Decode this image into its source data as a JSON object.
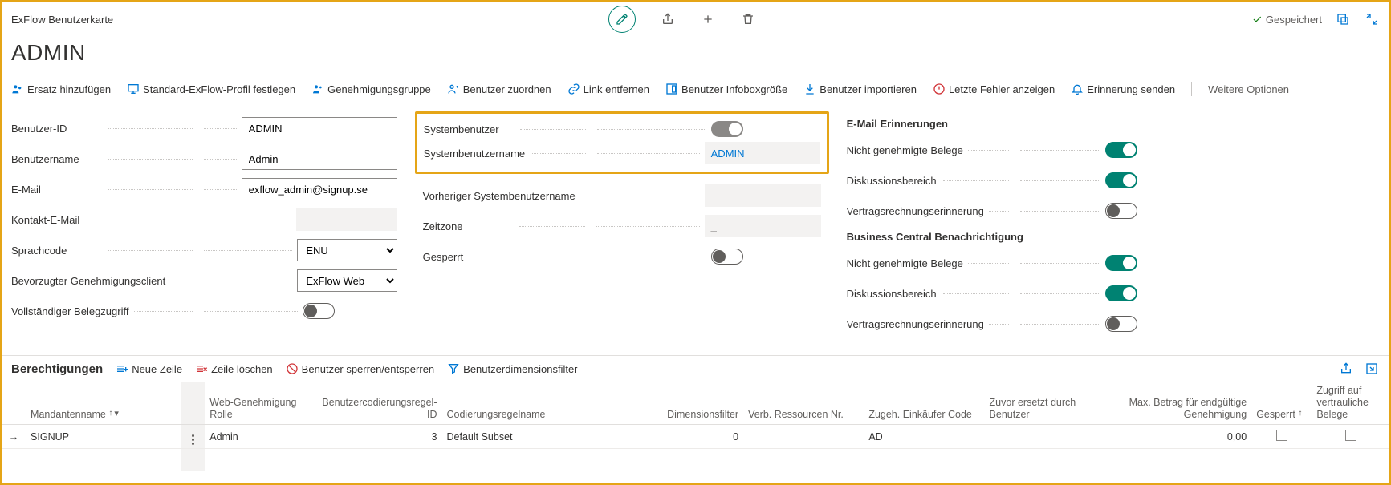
{
  "header": {
    "breadcrumb": "ExFlow Benutzerkarte",
    "title": "ADMIN",
    "saved_label": "Gespeichert"
  },
  "actions": {
    "ersatz": "Ersatz hinzufügen",
    "profil": "Standard-ExFlow-Profil festlegen",
    "gruppe": "Genehmigungsgruppe",
    "zuordnen": "Benutzer zuordnen",
    "link": "Link entfernen",
    "infobox": "Benutzer Infoboxgröße",
    "import": "Benutzer importieren",
    "fehler": "Letzte Fehler anzeigen",
    "erinnerung": "Erinnerung senden",
    "more": "Weitere Optionen"
  },
  "fields": {
    "user_id_label": "Benutzer-ID",
    "user_id": "ADMIN",
    "user_name_label": "Benutzername",
    "user_name": "Admin",
    "email_label": "E-Mail",
    "email": "exflow_admin@signup.se",
    "contact_email_label": "Kontakt-E-Mail",
    "contact_email": "",
    "lang_label": "Sprachcode",
    "lang": "ENU",
    "client_label": "Bevorzugter Genehmigungsclient",
    "client": "ExFlow Web",
    "full_access_label": "Vollständiger Belegzugriff"
  },
  "col2": {
    "sysuser_label": "Systembenutzer",
    "sysuser_name_label": "Systembenutzername",
    "sysuser_name": "ADMIN",
    "prev_sysuser_label": "Vorheriger Systembenutzername",
    "prev_sysuser": "",
    "timezone_label": "Zeitzone",
    "timezone": "_",
    "blocked_label": "Gesperrt"
  },
  "reminders": {
    "email_title": "E-Mail Erinnerungen",
    "not_approved": "Nicht genehmigte Belege",
    "discussion": "Diskussionsbereich",
    "contract": "Vertragsrechnungserinnerung",
    "bc_title": "Business Central Benachrichtigung"
  },
  "permissions": {
    "title": "Berechtigungen",
    "new_line": "Neue Zeile",
    "del_line": "Zeile löschen",
    "block_user": "Benutzer sperren/entsperren",
    "dim_filter": "Benutzerdimensionsfilter"
  },
  "grid": {
    "cols": {
      "mandant": "Mandantenname",
      "rolle": "Web-Genehmigung Rolle",
      "regel_id": "Benutzercodierungsregel-ID",
      "regel_name": "Codierungsregelname",
      "dimfilter": "Dimensionsfilter",
      "verb_res": "Verb. Ressourcen Nr.",
      "einkaeufer": "Zugeh. Einkäufer Code",
      "zuvor": "Zuvor ersetzt durch Benutzer",
      "maxbetrag": "Max. Betrag für endgültige Genehmigung",
      "gesperrt": "Gesperrt",
      "zugriff": "Zugriff auf vertrauliche Belege"
    },
    "rows": [
      {
        "mandant": "SIGNUP",
        "rolle": "Admin",
        "regel_id": "3",
        "regel_name": "Default Subset",
        "dimfilter": "0",
        "verb_res": "",
        "einkaeufer": "AD",
        "zuvor": "",
        "maxbetrag": "0,00"
      }
    ]
  }
}
